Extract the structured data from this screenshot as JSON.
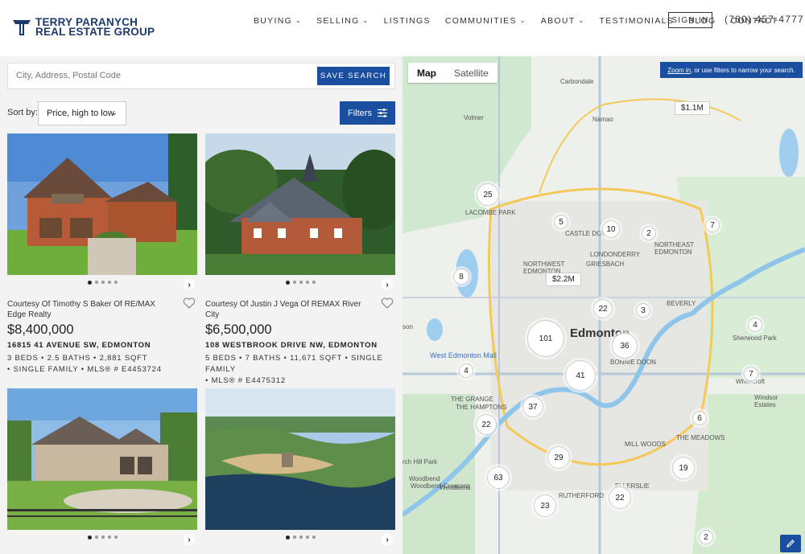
{
  "header": {
    "logo_line1": "TERRY PARANYCH",
    "logo_line2": "REAL ESTATE GROUP",
    "nav": [
      {
        "label": "BUYING",
        "has_dropdown": true
      },
      {
        "label": "SELLING",
        "has_dropdown": true
      },
      {
        "label": "LISTINGS",
        "has_dropdown": false
      },
      {
        "label": "COMMUNITIES",
        "has_dropdown": true
      },
      {
        "label": "ABOUT",
        "has_dropdown": true
      },
      {
        "label": "TESTIMONIALS",
        "has_dropdown": false
      },
      {
        "label": "BLOG",
        "has_dropdown": false
      },
      {
        "label": "CONTACT",
        "has_dropdown": false
      }
    ],
    "sign_in": "SIGN IN",
    "phone": "(780) 457-4777"
  },
  "search": {
    "placeholder": "City, Address, Postal Code",
    "save_label": "SAVE SEARCH"
  },
  "sort": {
    "label": "Sort by:",
    "selected": "Price, high to low"
  },
  "filters_label": "Filters",
  "listings": [
    {
      "courtesy": "Courtesy Of Timothy S Baker Of RE/MAX Edge Realty",
      "price": "$8,400,000",
      "address": "16815 41 AVENUE SW, EDMONTON",
      "facts_line1": "3 BEDS • 2.5 BATHS • 2,881 SQFT",
      "facts_line2": "• SINGLE FAMILY • MLS® # E4453724"
    },
    {
      "courtesy": "Courtesy Of Justin J Vega Of REMAX River City",
      "price": "$6,500,000",
      "address": "108 WESTBROOK DRIVE NW, EDMONTON",
      "facts_line1": "5 BEDS • 7 BATHS • 11,671 SQFT • SINGLE FAMILY",
      "facts_line2": "• MLS® # E4475312"
    },
    {
      "courtesy": "",
      "price": "",
      "address": "",
      "facts_line1": "",
      "facts_line2": ""
    },
    {
      "courtesy": "",
      "price": "",
      "address": "",
      "facts_line1": "",
      "facts_line2": ""
    }
  ],
  "map": {
    "tab_map": "Map",
    "tab_satellite": "Satellite",
    "zoom_hint_link": "Zoom in,",
    "zoom_hint_rest": "or use filters to narrow your search.",
    "city_label": "Edmonton",
    "labels": {
      "carbondale": "Carbondale",
      "volmer": "Volmer",
      "namao": "Namao",
      "lacombe": "LACOMBE PARK",
      "castle_downs": "CASTLE DOWNS",
      "northeast_edmonton": "NORTHEAST EDMONTON",
      "londonderry": "LONDONDERRY",
      "griesbach": "GRIESBACH",
      "northwest_edmonton": "NORTHWEST EDMONTON",
      "beverly": "BEVERLY",
      "west_ed_mall": "West Edmonton Mall",
      "bonnie_doon": "BONNIE DOON",
      "the_grange": "THE GRANGE",
      "the_hamptons": "THE HAMPTONS",
      "mill_woods": "MILL WOODS",
      "the_meadows": "THE MEADOWS",
      "woodbend": "Woodbend",
      "woodbend_crescent": "Woodbend Crescent",
      "rutherford": "RUTHERFORD",
      "ellerslie": "ELLERSLIE",
      "sherwood_park": "Sherwood Park",
      "windsor_estates": "Windsor Estates",
      "whitecroft": "Whitecroft",
      "birch_hill_park": "rch Hill Park",
      "stonybrook_hint": "son"
    },
    "price_pins": [
      "$1.1M",
      "$2.2M"
    ],
    "clusters": [
      "25",
      "5",
      "10",
      "2",
      "7",
      "8",
      "22",
      "3",
      "101",
      "36",
      "4",
      "41",
      "4",
      "7",
      "37",
      "22",
      "6",
      "29",
      "19",
      "63",
      "23",
      "22",
      "2"
    ]
  }
}
